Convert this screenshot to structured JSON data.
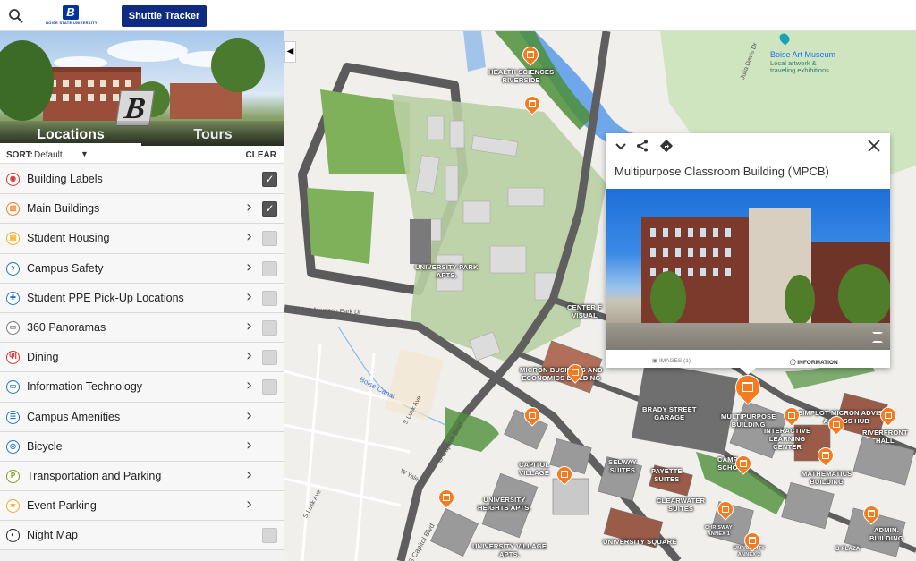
{
  "topbar": {
    "logo_wordmark": "BOISE STATE UNIVERSITY",
    "logo_mark": "B",
    "shuttle_label": "Shuttle Tracker"
  },
  "sidebar": {
    "hero_tabs": [
      {
        "label": "Locations",
        "active": true
      },
      {
        "label": "Tours",
        "active": false
      }
    ],
    "sort": {
      "label": "SORT:",
      "value": "Default",
      "clear_label": "CLEAR"
    },
    "layers": [
      {
        "label": "Building Labels",
        "icon": "label-icon",
        "icon_char": "◉",
        "color": "#d62d2d",
        "chevron": false,
        "checkbox": true,
        "checked": true
      },
      {
        "label": "Main Buildings",
        "icon": "building-icon",
        "icon_char": "▥",
        "color": "#f47b20",
        "chevron": true,
        "checkbox": true,
        "checked": true
      },
      {
        "label": "Student Housing",
        "icon": "housing-icon",
        "icon_char": "▤",
        "color": "#f2a81d",
        "chevron": true,
        "checkbox": true,
        "checked": false
      },
      {
        "label": "Campus Safety",
        "icon": "safety-icon",
        "icon_char": "⚕",
        "color": "#1e73c8",
        "chevron": true,
        "checkbox": true,
        "checked": false
      },
      {
        "label": "Student PPE Pick-Up Locations",
        "icon": "ppe-icon",
        "icon_char": "✚",
        "color": "#1e73c8",
        "chevron": true,
        "checkbox": true,
        "checked": false
      },
      {
        "label": "360 Panoramas",
        "icon": "panorama-icon",
        "icon_char": "▭",
        "color": "#777777",
        "chevron": true,
        "checkbox": true,
        "checked": false
      },
      {
        "label": "Dining",
        "icon": "dining-icon",
        "icon_char": "ΨΙ",
        "color": "#d62d2d",
        "chevron": true,
        "checkbox": true,
        "checked": false
      },
      {
        "label": "Information Technology",
        "icon": "computer-icon",
        "icon_char": "▭",
        "color": "#1e73c8",
        "chevron": true,
        "checkbox": true,
        "checked": false
      },
      {
        "label": "Campus Amenities",
        "icon": "amenities-icon",
        "icon_char": "☰",
        "color": "#1e73c8",
        "chevron": true,
        "checkbox": false,
        "checked": false
      },
      {
        "label": "Bicycle",
        "icon": "bicycle-icon",
        "icon_char": "◎",
        "color": "#1e73c8",
        "chevron": true,
        "checkbox": false,
        "checked": false
      },
      {
        "label": "Transportation and Parking",
        "icon": "parking-icon",
        "icon_char": "P",
        "color": "#7a9a1e",
        "chevron": true,
        "checkbox": false,
        "checked": false
      },
      {
        "label": "Event Parking",
        "icon": "star-icon",
        "icon_char": "★",
        "color": "#f2a81d",
        "chevron": true,
        "checkbox": false,
        "checked": false
      },
      {
        "label": "Night Map",
        "icon": "moon-icon",
        "icon_char": "◐",
        "color": "#222222",
        "chevron": false,
        "checkbox": true,
        "checked": false
      }
    ]
  },
  "map": {
    "building_labels": [
      "HEALTH SCIENCES\nRIVERSIDE",
      "UNIVERSITY PARK\nAPTS.",
      "CENTER F\nVISUAL",
      "MICRON BUSINESS AND\nECONOMICS BUILDING",
      "BRADY STREET\nGARAGE",
      "MULTIPURPOSE\nBUILDING",
      "INTERACTIVE\nLEARNING\nCENTER",
      "SIMPLOT MICRON ADVISING\nACCESS HUB",
      "RIVERFRONT\nHALL",
      "CAPITOL\nVILLAGE",
      "SELWAY\nSUITES",
      "PAYETTE\nSUITES",
      "CAMP\nSCHO",
      "MATHEMATICS\nBUILDING",
      "UNIVERSITY\nHEIGHTS APTS.",
      "CLEARWATER\nSUITES",
      "UNIVERSITY VILLAGE\nAPTS.",
      "UNIVERSITY SQUARE",
      "CHRISWAY\nANNEX 1",
      "UNIVERSITY\nANNEX 2",
      "ADMIN.\nBUILDING",
      "B PLAZA"
    ],
    "streets": [
      "W Ann Morrison Park Dr",
      "Boise Canal",
      "S Lusk Ave",
      "S Capitol Blvd",
      "W Yale St",
      "S Capitol Blvd",
      "S Lusk Ave",
      "Julia Davis Dr"
    ],
    "poi": {
      "name": "Boise Art Museum",
      "sub1": "Local artwork &",
      "sub2": "traveling exhibitions"
    },
    "river_color": "#6fa7ea",
    "park_color": "#b5d7a1"
  },
  "popup": {
    "title": "Multipurpose Classroom Building (MPCB)",
    "tabs": [
      {
        "label": "IMAGES (1)",
        "active": false
      },
      {
        "label": "INFORMATION",
        "active": true
      }
    ]
  }
}
